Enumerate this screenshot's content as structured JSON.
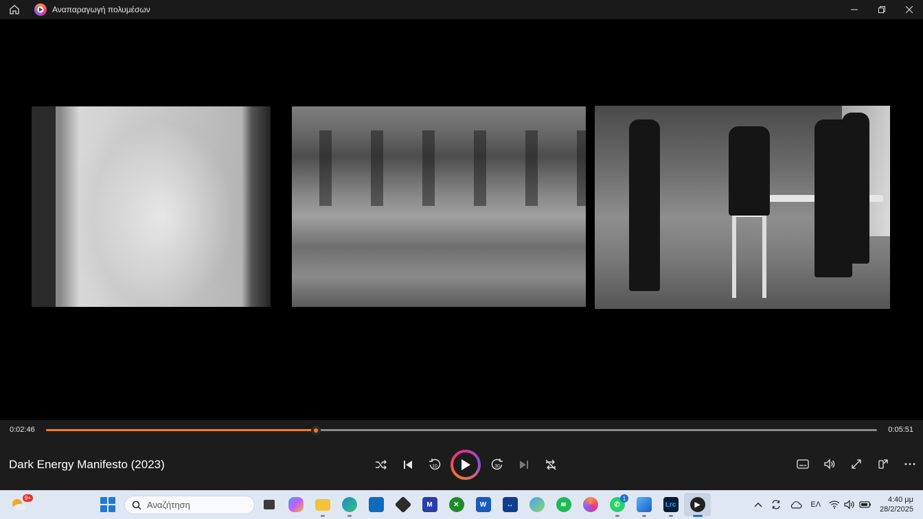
{
  "window": {
    "title": "Αναπαραγωγή πολυμέσων",
    "controls": {
      "minimize": "—",
      "maximize": "❐",
      "close": "✕"
    }
  },
  "player": {
    "current_time": "0:02:46",
    "total_time": "0:05:51",
    "progress_fraction": 0.325,
    "media_title": "Dark Energy Manifesto  (2023)",
    "skip_back_seconds": "10",
    "skip_forward_seconds": "30",
    "accent_color": "#f47c20"
  },
  "taskbar": {
    "weather_badge": "9+",
    "search_placeholder": "Αναζήτηση",
    "whatsapp_badge": "1",
    "lightroom_label": "Lrc",
    "language": "ΕΛ",
    "time": "4:40 μμ",
    "date": "28/2/2025"
  }
}
